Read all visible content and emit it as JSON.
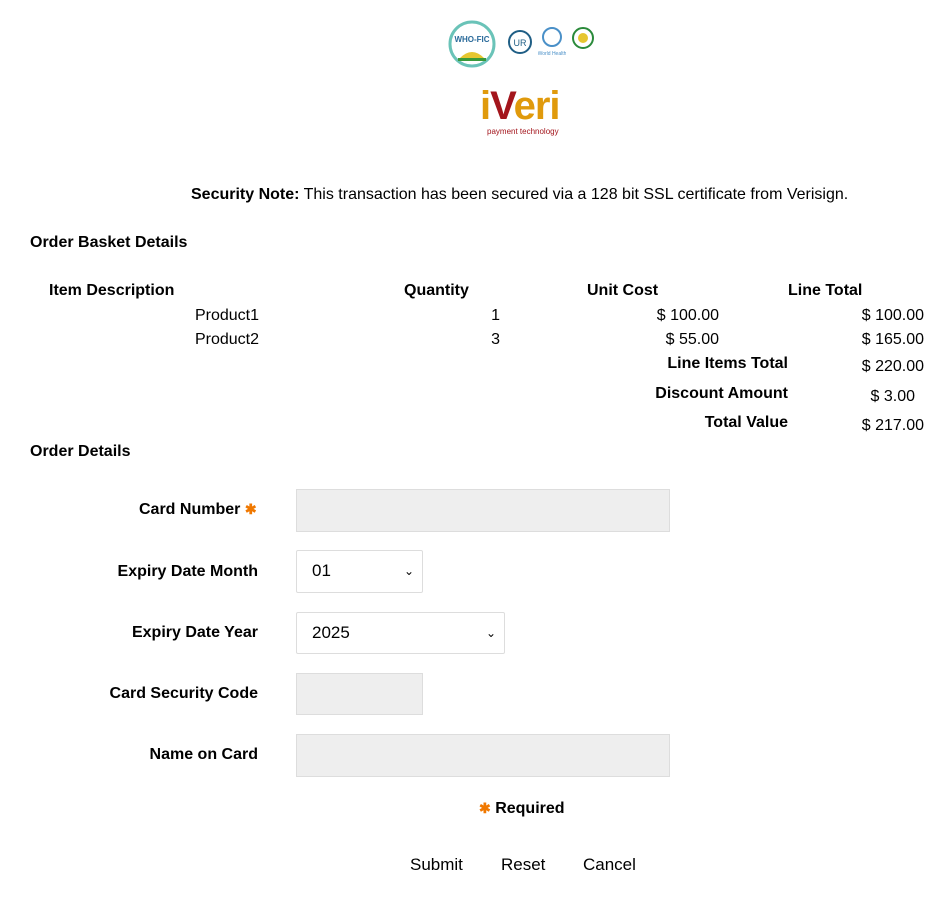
{
  "logos": {
    "who_fic": "WHO-FIC",
    "who": "World Health Organization",
    "iveri": "iveri",
    "iveri_tag": "payment technology"
  },
  "security": {
    "label": "Security Note:",
    "text": " This transaction has been secured via a 128 bit SSL certificate from Verisign."
  },
  "basket": {
    "title": "Order Basket Details",
    "headers": [
      "Item Description",
      "Quantity",
      "Unit Cost",
      "Line Total"
    ],
    "rows": [
      {
        "desc": "Product1",
        "qty": "1",
        "unit": "$ 100.00",
        "total": "$ 100.00"
      },
      {
        "desc": "Product2",
        "qty": "3",
        "unit": "$ 55.00",
        "total": "$ 165.00"
      }
    ],
    "line_items_label": "Line Items Total",
    "line_items_value": "$ 220.00",
    "discount_label": "Discount Amount",
    "discount_value": "$ 3.00",
    "total_label": "Total Value",
    "total_value": "$ 217.00"
  },
  "order": {
    "title": "Order Details",
    "card_number_label": "Card Number",
    "card_number_value": "",
    "month_label": "Expiry Date Month",
    "month_value": "01",
    "year_label": "Expiry Date Year",
    "year_value": "2025",
    "cvv_label": "Card Security Code",
    "cvv_value": "",
    "name_label": "Name on Card",
    "name_value": "",
    "required_label": "Required"
  },
  "buttons": {
    "submit": "Submit",
    "reset": "Reset",
    "cancel": "Cancel"
  },
  "colors": {
    "required_star": "#f07800",
    "iveri_red": "#a3151c",
    "iveri_gold": "#e09a0c",
    "input_bg": "#eeeeee"
  }
}
